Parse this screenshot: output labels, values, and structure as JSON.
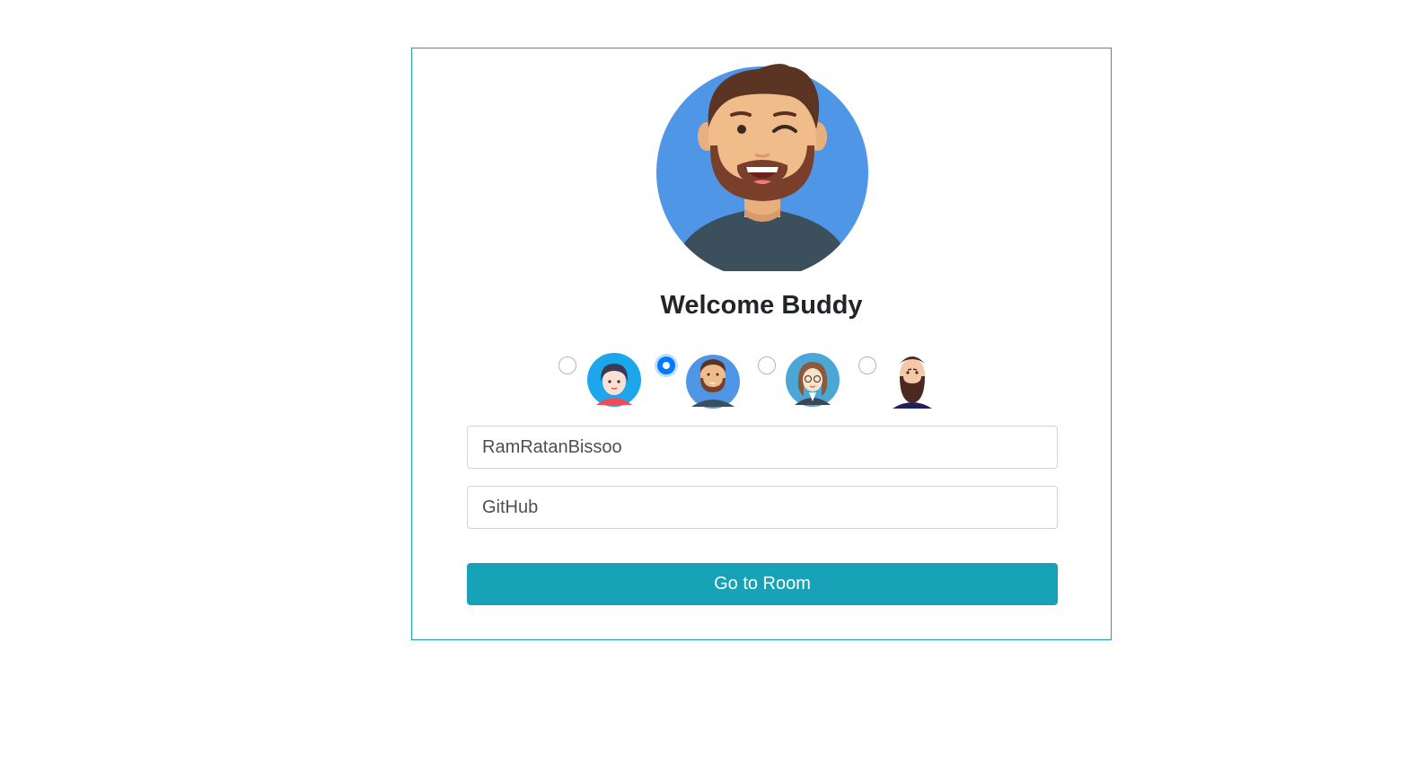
{
  "welcome": {
    "title": "Welcome Buddy"
  },
  "avatars": {
    "options": [
      {
        "name": "girl-avatar",
        "selected": false
      },
      {
        "name": "bearded-man-avatar",
        "selected": true
      },
      {
        "name": "woman-glasses-avatar",
        "selected": false
      },
      {
        "name": "bald-bearded-man-avatar",
        "selected": false
      }
    ]
  },
  "form": {
    "username_value": "RamRatanBissoo",
    "room_value": "GitHub",
    "submit_label": "Go to Room"
  },
  "colors": {
    "accent": "#17a2b8",
    "radio_checked": "#007bff",
    "avatar_bg": "#4f97e6"
  }
}
